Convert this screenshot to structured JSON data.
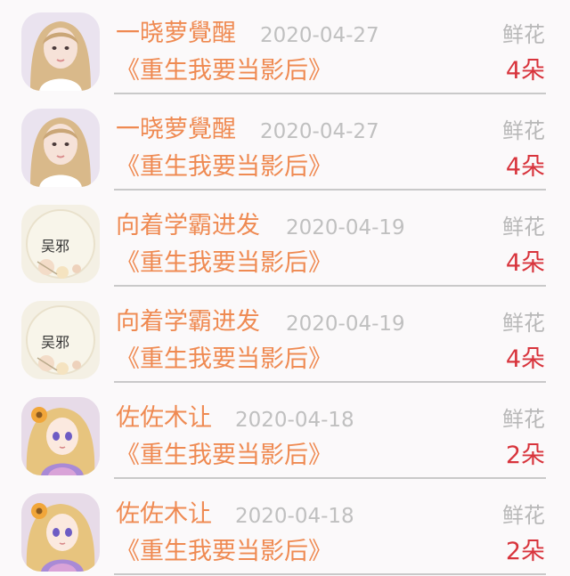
{
  "rows": [
    {
      "name": "一晓萝覺醒",
      "date": "2020-04-27",
      "book": "《重生我要当影后》",
      "gift": "鲜花",
      "count": "4朵",
      "avatar": "girl-avatar"
    },
    {
      "name": "一晓萝覺醒",
      "date": "2020-04-27",
      "book": "《重生我要当影后》",
      "gift": "鲜花",
      "count": "4朵",
      "avatar": "girl-avatar"
    },
    {
      "name": "向着学霸进发",
      "date": "2020-04-19",
      "book": "《重生我要当影后》",
      "gift": "鲜花",
      "count": "4朵",
      "avatar": "calligraphy-avatar",
      "avatar_text": "吴邪"
    },
    {
      "name": "向着学霸进发",
      "date": "2020-04-19",
      "book": "《重生我要当影后》",
      "gift": "鲜花",
      "count": "4朵",
      "avatar": "calligraphy-avatar",
      "avatar_text": "吴邪"
    },
    {
      "name": "佐佐木让",
      "date": "2020-04-18",
      "book": "《重生我要当影后》",
      "gift": "鲜花",
      "count": "2朵",
      "avatar": "anime-avatar"
    },
    {
      "name": "佐佐木让",
      "date": "2020-04-18",
      "book": "《重生我要当影后》",
      "gift": "鲜花",
      "count": "2朵",
      "avatar": "anime-avatar"
    }
  ],
  "colors": {
    "name": "#ef8a52",
    "date": "#c0c0c0",
    "count": "#d8343c",
    "gift": "#b8b8b8"
  }
}
